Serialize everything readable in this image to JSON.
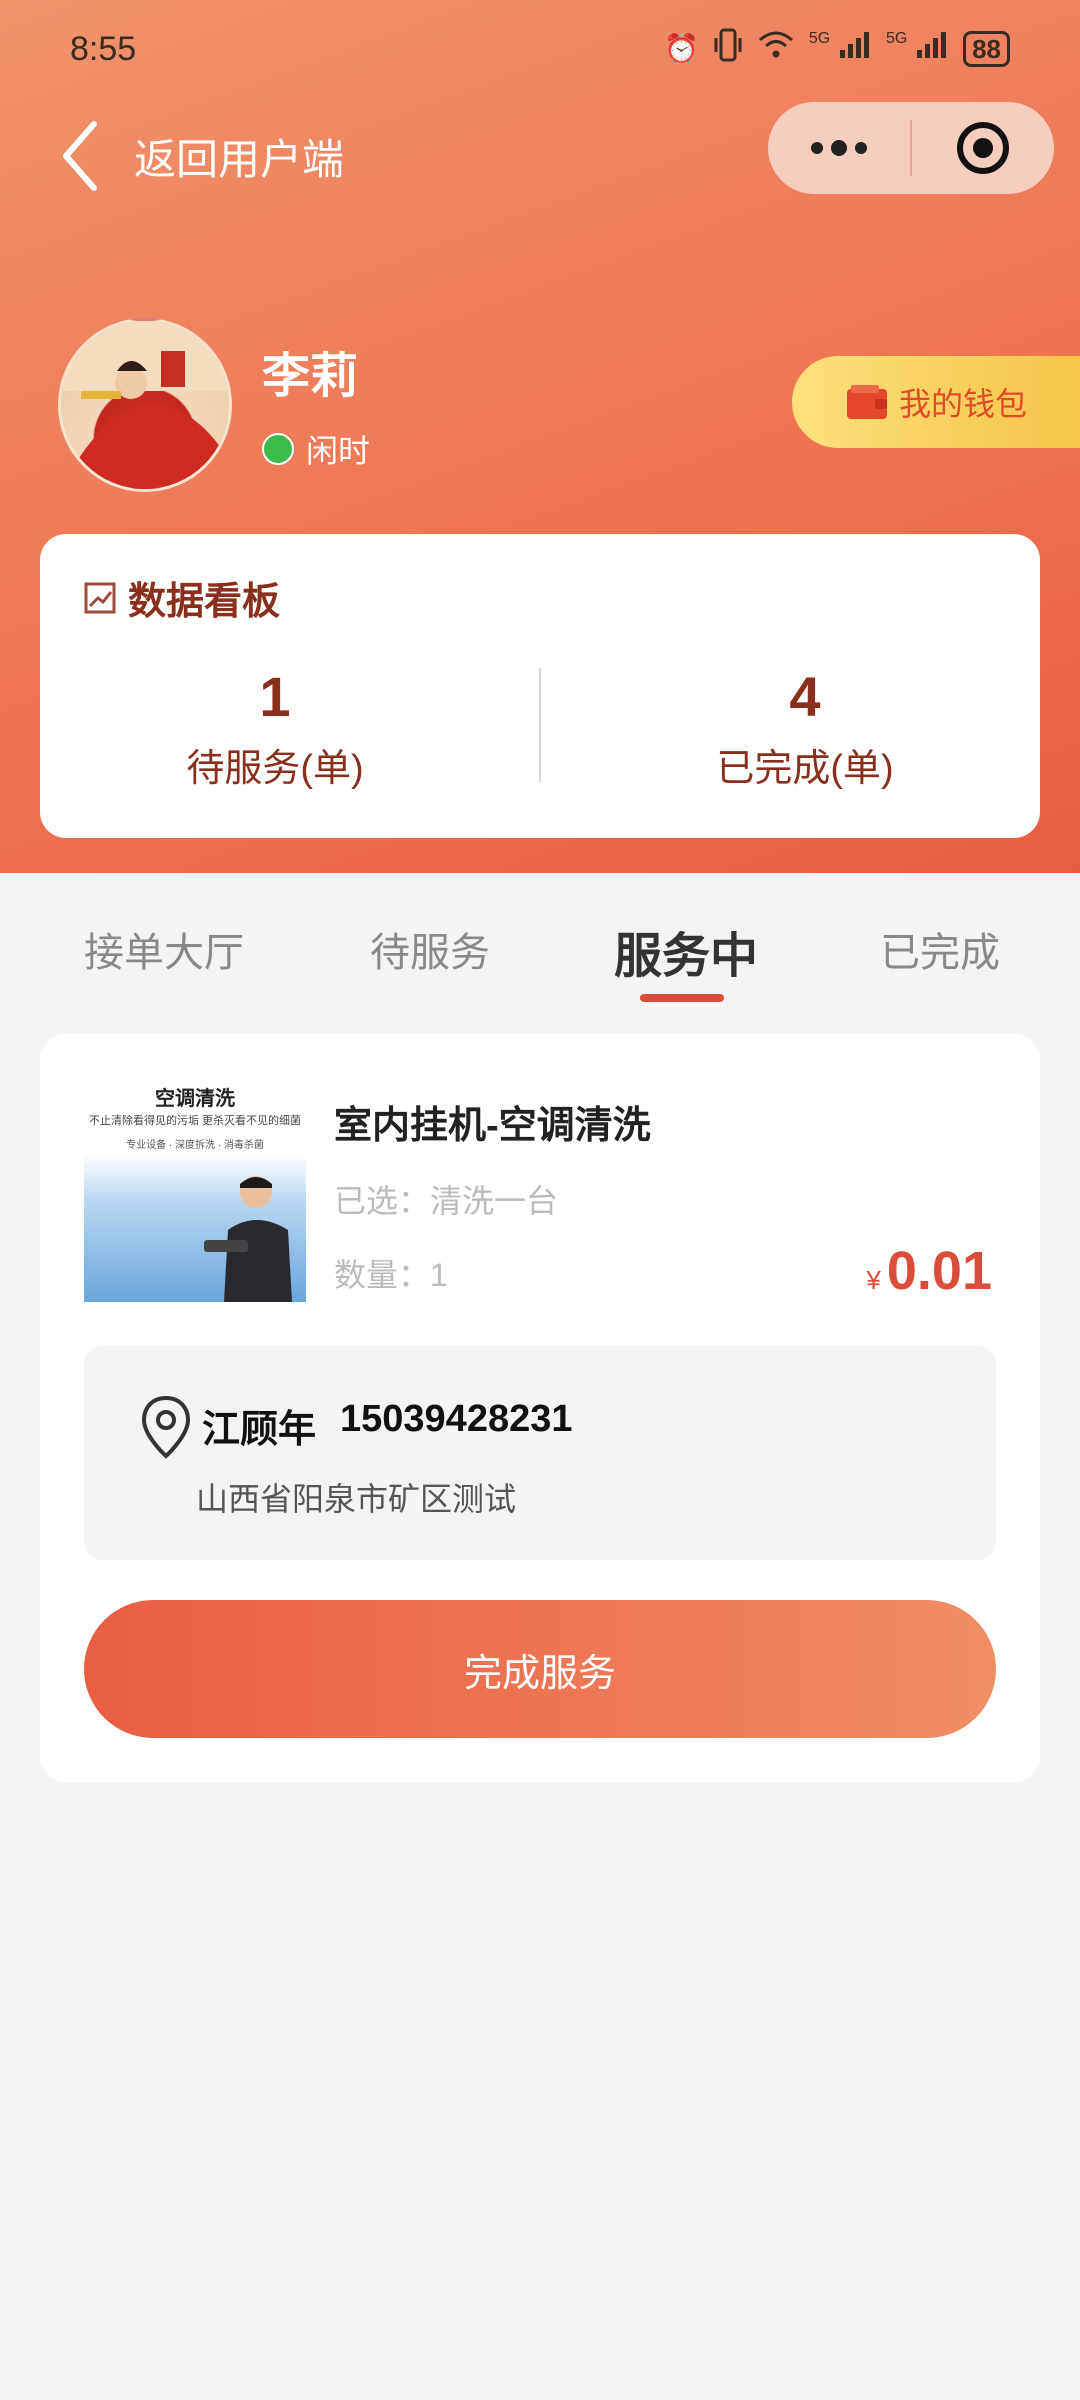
{
  "status_bar": {
    "time": "8:55",
    "network": "5G",
    "battery": "88",
    "icons": [
      "alarm-icon",
      "vibrate-icon",
      "wifi-icon",
      "signal-5g-icon",
      "signal-5g-icon",
      "battery-icon"
    ]
  },
  "nav": {
    "back_label": "返回用户端",
    "icons": [
      "chevron-left-icon",
      "more-dots-icon",
      "target-icon"
    ]
  },
  "profile": {
    "name": "李莉",
    "status": "闲时",
    "status_color": "#3dbb4a",
    "wallet_label": "我的钱包",
    "wallet_icon": "wallet-icon"
  },
  "dashboard": {
    "title": "数据看板",
    "icon": "chart-icon",
    "stats": [
      {
        "value": "1",
        "label": "待服务(单)"
      },
      {
        "value": "4",
        "label": "已完成(单)"
      }
    ]
  },
  "tabs": [
    {
      "label": "接单大厅"
    },
    {
      "label": "待服务"
    },
    {
      "label": "服务中",
      "active": true
    },
    {
      "label": "已完成"
    }
  ],
  "order": {
    "image": {
      "title": "空调清洗",
      "subtitle": "不止清除看得见的污垢 更杀灭看不见的细菌",
      "tags": "专业设备 · 深度拆洗 · 消毒杀菌"
    },
    "title": "室内挂机-空调清洗",
    "spec": "已选：清洗一台",
    "qty": "数量：1",
    "currency": "¥",
    "price": "0.01",
    "contact_name": "江顾年",
    "contact_phone": "15039428231",
    "address": "山西省阳泉市矿区测试",
    "action_label": "完成服务"
  },
  "colors": {
    "accent": "#d94d3a",
    "header_gradient_start": "#f0946a",
    "header_gradient_end": "#e85d3f",
    "dashboard_text": "#8a2f1e"
  }
}
